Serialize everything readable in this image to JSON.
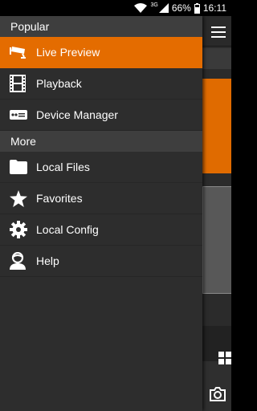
{
  "status_bar": {
    "network": "3G",
    "battery": "66%",
    "time": "16:11"
  },
  "drawer": {
    "sections": [
      {
        "title": "Popular",
        "items": [
          {
            "label": "Live Preview",
            "icon": "cctv-camera-icon",
            "active": true
          },
          {
            "label": "Playback",
            "icon": "film-strip-icon",
            "active": false
          },
          {
            "label": "Device Manager",
            "icon": "dvr-device-icon",
            "active": false
          }
        ]
      },
      {
        "title": "More",
        "items": [
          {
            "label": "Local Files",
            "icon": "folder-icon",
            "active": false
          },
          {
            "label": "Favorites",
            "icon": "star-icon",
            "active": false
          },
          {
            "label": "Local Config",
            "icon": "gear-icon",
            "active": false
          },
          {
            "label": "Help",
            "icon": "person-help-icon",
            "active": false
          }
        ]
      }
    ]
  },
  "colors": {
    "accent": "#e46c00",
    "drawer_bg": "#2d2d2d",
    "section_bg": "#3e3e3e"
  }
}
